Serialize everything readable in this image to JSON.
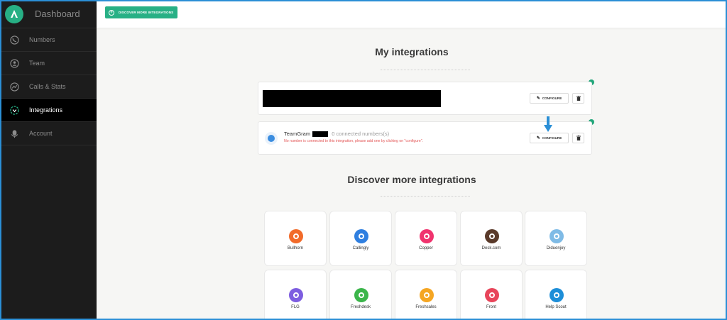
{
  "sidebar": {
    "brand_title": "Dashboard",
    "items": [
      {
        "label": "Numbers",
        "icon": "phone-icon",
        "active": false
      },
      {
        "label": "Team",
        "icon": "user-icon",
        "active": false
      },
      {
        "label": "Calls & Stats",
        "icon": "stats-icon",
        "active": false
      },
      {
        "label": "Integrations",
        "icon": "integrations-icon",
        "active": true
      },
      {
        "label": "Account",
        "icon": "account-icon",
        "active": false
      }
    ]
  },
  "topbar": {
    "discover_label": "DISCOVER MORE INTEGRATIONS"
  },
  "my_integrations": {
    "title": "My integrations",
    "configure_label": "CONFIGURE",
    "teamgram": {
      "name": "TeamGram",
      "count": "0 connected numbers(s)",
      "warning": "No number is connected to this integration, please add one by clicking on \"configure\"."
    }
  },
  "discover": {
    "title": "Discover more integrations",
    "tiles": [
      {
        "label": "Bullhorn",
        "icon": "bullhorn-icon",
        "color": "#f26b2a"
      },
      {
        "label": "Callingly",
        "icon": "callingly-icon",
        "color": "#2f7fe0"
      },
      {
        "label": "Copper",
        "icon": "copper-icon",
        "color": "#f0336e"
      },
      {
        "label": "Desk.com",
        "icon": "desk-icon",
        "color": "#5a3a2a"
      },
      {
        "label": "Diduenjoy",
        "icon": "diduenjoy-icon",
        "color": "#7fbbe6"
      },
      {
        "label": "FLG",
        "icon": "flg-icon",
        "color": "#7d5de0"
      },
      {
        "label": "Freshdesk",
        "icon": "freshdesk-icon",
        "color": "#3bb54a"
      },
      {
        "label": "Freshsales",
        "icon": "freshsales-icon",
        "color": "#f5a623"
      },
      {
        "label": "Front",
        "icon": "front-icon",
        "color": "#e8455a"
      },
      {
        "label": "Help Scout",
        "icon": "helpscout-icon",
        "color": "#1e8ed8"
      }
    ]
  },
  "colors": {
    "accent": "#27b085",
    "sidebar_bg": "#1c1c1c",
    "warning": "#e25454",
    "arrow": "#2b8fd6"
  }
}
